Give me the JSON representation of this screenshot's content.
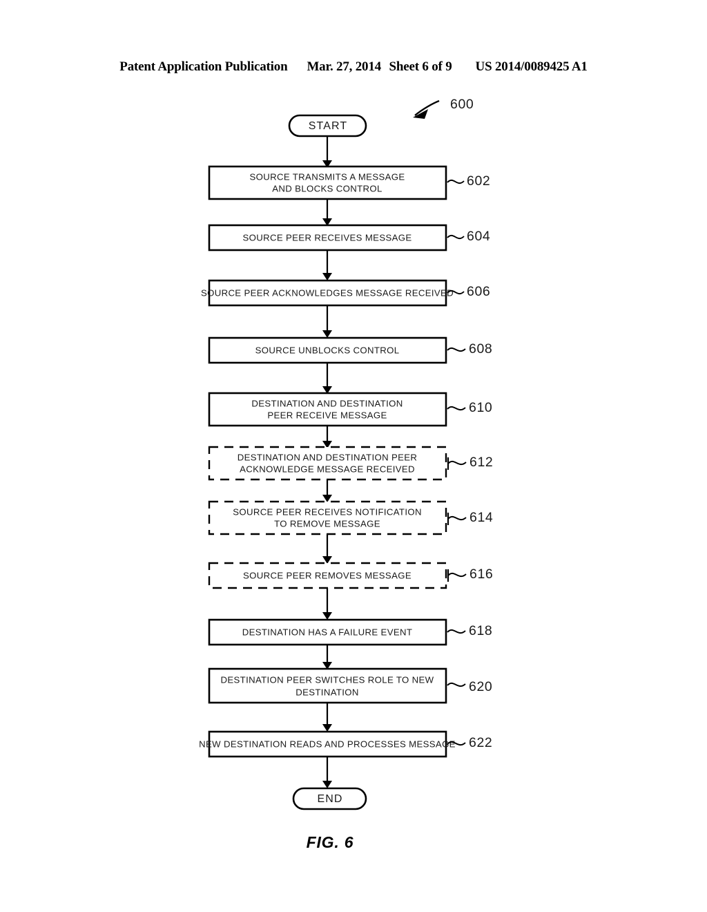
{
  "header": {
    "left": "Patent Application Publication",
    "date": "Mar. 27, 2014",
    "sheet": "Sheet 6 of 9",
    "publication_number": "US 2014/0089425 A1"
  },
  "figure": {
    "caption": "FIG. 6",
    "diagram_reference": "600"
  },
  "flowchart": {
    "start_label": "START",
    "end_label": "END",
    "steps": [
      {
        "ref": "602",
        "style": "solid",
        "lines": [
          "SOURCE TRANSMITS A MESSAGE",
          "AND BLOCKS CONTROL"
        ]
      },
      {
        "ref": "604",
        "style": "solid",
        "lines": [
          "SOURCE PEER RECEIVES MESSAGE"
        ]
      },
      {
        "ref": "606",
        "style": "solid",
        "lines": [
          "SOURCE PEER ACKNOWLEDGES MESSAGE RECEIVED"
        ]
      },
      {
        "ref": "608",
        "style": "solid",
        "lines": [
          "SOURCE UNBLOCKS CONTROL"
        ]
      },
      {
        "ref": "610",
        "style": "solid",
        "lines": [
          "DESTINATION AND DESTINATION",
          "PEER RECEIVE MESSAGE"
        ]
      },
      {
        "ref": "612",
        "style": "dashed",
        "lines": [
          "DESTINATION AND DESTINATION PEER",
          "ACKNOWLEDGE MESSAGE RECEIVED"
        ]
      },
      {
        "ref": "614",
        "style": "dashed",
        "lines": [
          "SOURCE PEER RECEIVES NOTIFICATION",
          "TO REMOVE MESSAGE"
        ]
      },
      {
        "ref": "616",
        "style": "dashed",
        "lines": [
          "SOURCE PEER REMOVES MESSAGE"
        ]
      },
      {
        "ref": "618",
        "style": "solid",
        "lines": [
          "DESTINATION HAS A FAILURE EVENT"
        ]
      },
      {
        "ref": "620",
        "style": "solid",
        "lines": [
          "DESTINATION PEER SWITCHES ROLE TO NEW",
          "DESTINATION"
        ]
      },
      {
        "ref": "622",
        "style": "solid",
        "lines": [
          "NEW DESTINATION READS AND PROCESSES MESSAGE"
        ]
      }
    ]
  },
  "colors": {
    "ink": "#000000",
    "paper": "#ffffff"
  }
}
